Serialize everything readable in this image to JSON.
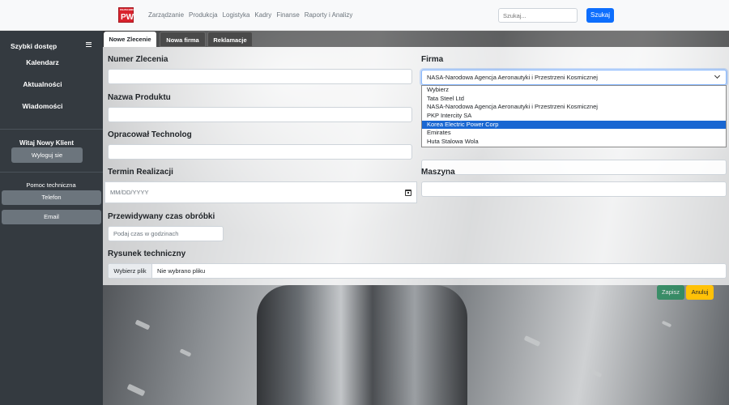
{
  "navbar": {
    "logo_top": "POLITECHNIKA",
    "logo_main": "PW",
    "links": [
      "Zarządzanie",
      "Produkcja",
      "Logistyka",
      "Kadry",
      "Finanse",
      "Raporty i Analizy"
    ],
    "search_placeholder": "Szukaj...",
    "search_button": "Szukaj"
  },
  "sidebar": {
    "title": "Szybki dostęp",
    "links": [
      "Kalendarz",
      "Aktualności",
      "Wiadomości"
    ],
    "welcome": "Witaj Nowy Klient",
    "logout": "Wyloguj sie",
    "help_title": "Pomoc techniczna",
    "phone": "Telefon",
    "email": "Email"
  },
  "tabs": [
    "Nowe Zlecenie",
    "Nowa firma",
    "Reklamacje"
  ],
  "form": {
    "order_number_label": "Numer Zlecenia",
    "product_name_label": "Nazwa Produktu",
    "technologist_label": "Opracował Technolog",
    "deadline_label": "Termin Realizacji",
    "deadline_placeholder": "MM/DD/YYYY",
    "time_label": "Przewidywany czas obróbki",
    "time_placeholder": "Podaj czas w godzinach",
    "drawing_label": "Rysunek techniczny",
    "file_button": "Wybierz plik",
    "file_status": "Nie wybrano pliku",
    "company_label": "Firma",
    "company_selected": "NASA-Narodowa Agencja Aeronautyki i Przestrzeni Kosmicznej",
    "company_options": [
      "Wybierz",
      "Tata Steel Ltd",
      "NASA-Narodowa Agencja Aeronautyki i Przestrzeni Kosmicznej",
      "PKP Intercity SA",
      "Korea Electric Power Corp",
      "Emirates",
      "Huta Stalowa Wola"
    ],
    "highlighted_option": "Korea Electric Power Corp",
    "machine_label": "Maszyna",
    "save_button": "Zapisz",
    "cancel_button": "Anuluj"
  },
  "colors": {
    "primary": "#0d6efd",
    "success": "#198754",
    "warning": "#ffc107",
    "sidebar_bg": "#343a40",
    "option_highlight": "#1967d2"
  }
}
